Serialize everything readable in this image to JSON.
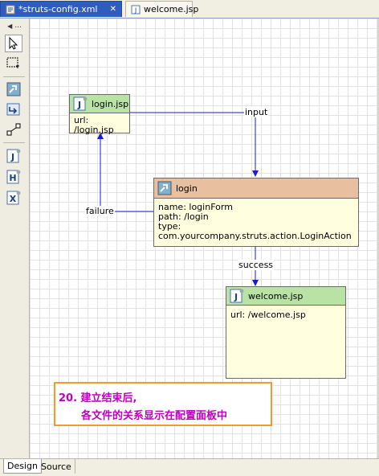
{
  "tabs": [
    {
      "label": "*struts-config.xml",
      "icon": "struts-config-file-icon",
      "active": true
    },
    {
      "label": "welcome.jsp",
      "icon": "jsp-file-icon",
      "active": false
    }
  ],
  "palette": {
    "menu_label": "...",
    "tools": [
      "select-arrow-icon",
      "marquee-select-icon",
      "action-mapping-tool-icon",
      "forward-tool-icon",
      "connection-tool-icon",
      "jsp-page-tool-icon",
      "html-page-tool-icon",
      "other-page-tool-icon"
    ]
  },
  "diagram": {
    "login_jsp": {
      "title": "login.jsp",
      "url": "url: /login.jsp"
    },
    "login_action": {
      "title": "login",
      "lines": [
        "name: loginForm",
        "path: /login",
        "type: com.yourcompany.struts.action.LoginAction"
      ]
    },
    "welcome_jsp": {
      "title": "welcome.jsp",
      "url": "url: /welcome.jsp"
    },
    "wires": {
      "input": "input",
      "failure": "failure",
      "success": "success"
    }
  },
  "note": {
    "line1": "20. 建立结束后,",
    "line2": "各文件的关系显示在配置面板中"
  },
  "bottom_tabs": [
    {
      "label": "Design",
      "active": true
    },
    {
      "label": "Source",
      "active": false
    }
  ],
  "colors": {
    "jsp_header": "#b9e3a5",
    "action_header": "#e9c09f",
    "wire": "#1a1adb",
    "note_border": "#f59a2a",
    "note_text": "#c000c0"
  }
}
